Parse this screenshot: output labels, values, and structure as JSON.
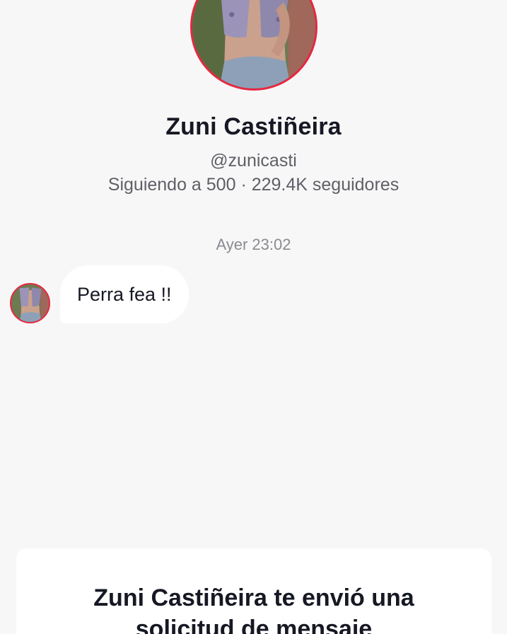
{
  "profile": {
    "name": "Zuni Castiñeira",
    "handle": "@zunicasti",
    "stats": "Siguiendo a 500 · 229.4K seguidores",
    "avatar_icon": "profile-photo",
    "ring_color": "#e8263f"
  },
  "chat": {
    "timestamp": "Ayer 23:02",
    "messages": [
      {
        "text": "Perra fea !!",
        "from": "other"
      }
    ]
  },
  "request_card": {
    "text_line1": "Zuni Castiñeira te envió una",
    "text_line2": "solicitud de mensaje"
  },
  "colors": {
    "background": "#f7f7f7",
    "bubble": "#ffffff",
    "text_primary": "#161823",
    "text_secondary": "#5f6066",
    "text_muted": "#8a8b91"
  }
}
